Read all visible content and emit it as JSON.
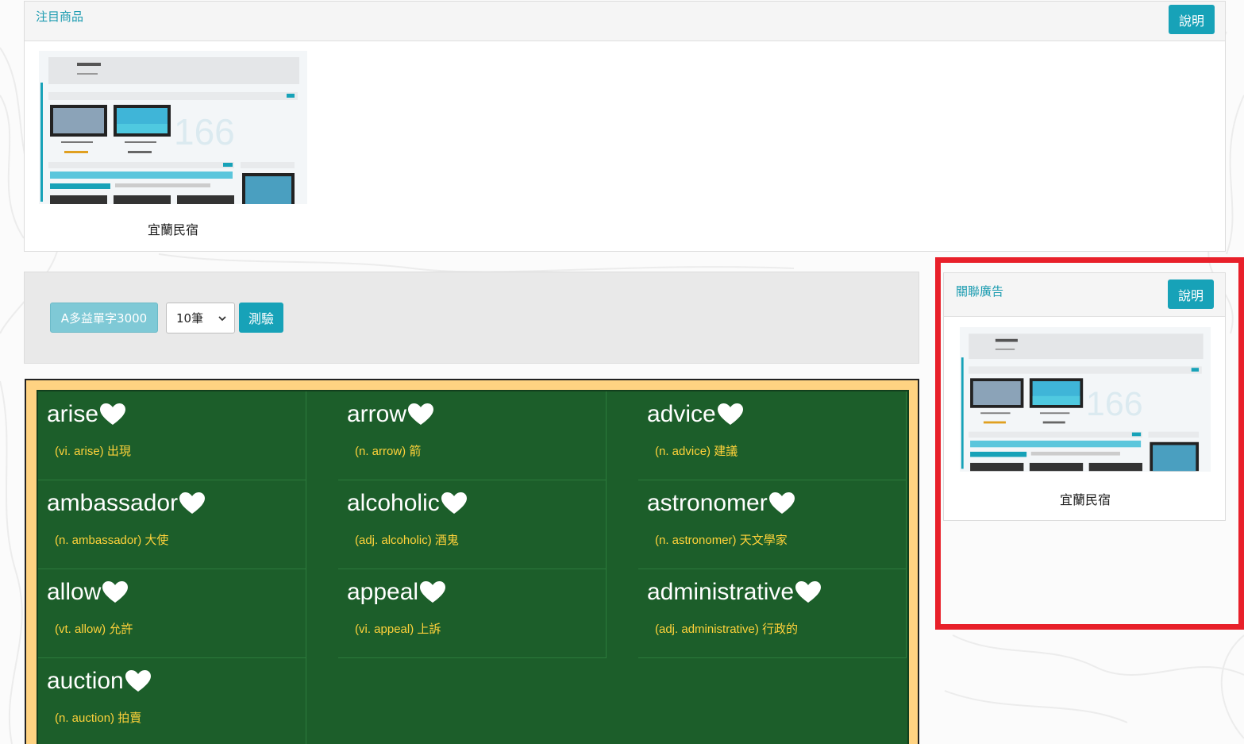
{
  "featured": {
    "title": "注目商品",
    "help_label": "說明",
    "item": {
      "caption": "宜蘭民宿",
      "thumb_icon": "website-screenshot-icon"
    }
  },
  "ad": {
    "title": "關聯廣告",
    "help_label": "說明",
    "item": {
      "caption": "宜蘭民宿",
      "thumb_icon": "website-screenshot-icon"
    }
  },
  "quiz": {
    "book_label": "A多益單字3000",
    "count_value": "10筆",
    "quiz_label": "測驗"
  },
  "words": [
    {
      "word": "arise",
      "def": "(vi. arise) 出現"
    },
    {
      "word": "arrow",
      "def": "(n. arrow) 箭"
    },
    {
      "word": "advice",
      "def": "(n. advice) 建議"
    },
    {
      "word": "ambassador",
      "def": "(n. ambassador) 大使"
    },
    {
      "word": "alcoholic",
      "def": "(adj. alcoholic) 酒鬼"
    },
    {
      "word": "astronomer",
      "def": "(n. astronomer) 天文學家"
    },
    {
      "word": "allow",
      "def": "(vt. allow) 允許"
    },
    {
      "word": "appeal",
      "def": "(vi. appeal) 上訴"
    },
    {
      "word": "administrative",
      "def": "(adj. administrative) 行政的"
    },
    {
      "word": "auction",
      "def": "(n. auction) 拍賣"
    }
  ],
  "colors": {
    "accent": "#17a2b8",
    "board": "#1c5e2a",
    "board_frame": "#ffd382",
    "definition": "#ffd23a",
    "highlight": "#e8202a"
  }
}
